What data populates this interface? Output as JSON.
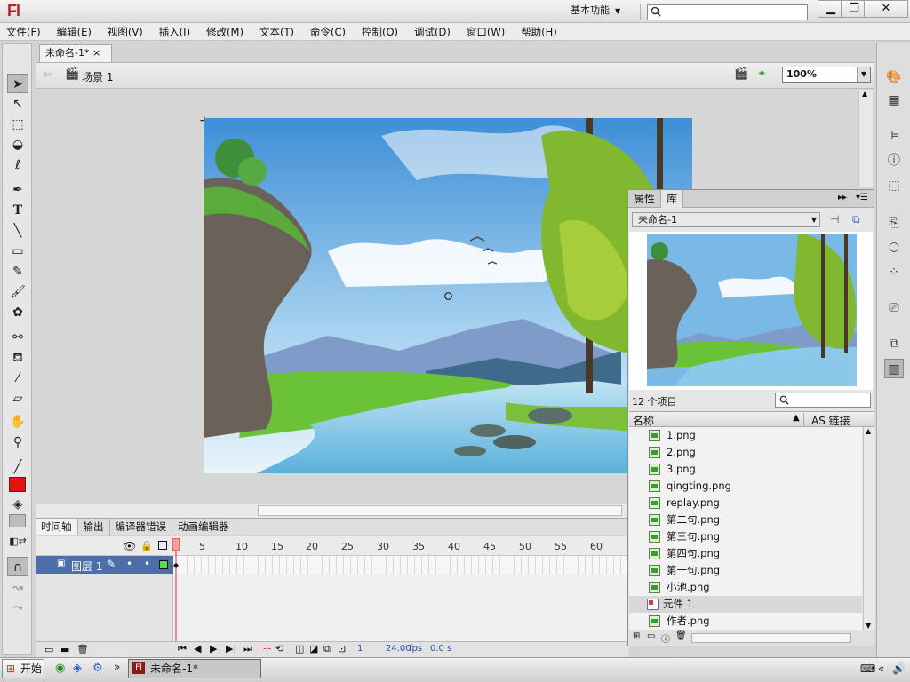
{
  "app": {
    "logo": "Fl",
    "workspace": "基本功能",
    "window_min": "▁",
    "window_max": "❐",
    "window_close": "✕"
  },
  "menu": [
    "文件(F)",
    "编辑(E)",
    "视图(V)",
    "插入(I)",
    "修改(M)",
    "文本(T)",
    "命令(C)",
    "控制(O)",
    "调试(D)",
    "窗口(W)",
    "帮助(H)"
  ],
  "document": {
    "tab": "未命名-1*",
    "close": "×",
    "scene": "场景 1",
    "zoom": "100%"
  },
  "timeline": {
    "tabs": [
      "时间轴",
      "输出",
      "编译器错误",
      "动画编辑器"
    ],
    "ruler": [
      "1",
      "5",
      "10",
      "15",
      "20",
      "25",
      "30",
      "35",
      "40",
      "45",
      "50",
      "55",
      "60"
    ],
    "layer": "图层 1",
    "current_frame": "1",
    "fps": "24.00",
    "fps_unit": "fps",
    "time": "0.0 s"
  },
  "library": {
    "tabs": [
      "属性",
      "库"
    ],
    "doc": "未命名-1",
    "count": "12 个项目",
    "col_name": "名称",
    "col_link": "AS 链接",
    "items": [
      "1.png",
      "2.png",
      "3.png",
      "qingting.png",
      "replay.png",
      "第二句.png",
      "第三句.png",
      "第四句.png",
      "第一句.png",
      "小池.png",
      "元件 1",
      "作者.png"
    ],
    "selected_item": "元件 1"
  },
  "taskbar": {
    "start": "开始",
    "item": "未命名-1*"
  },
  "colors": {
    "stroke": "#000000",
    "fill": "#e81010",
    "layer_color": "#54e04a",
    "timeline_selected": "#4e6fa6",
    "logo": "#c02020"
  }
}
